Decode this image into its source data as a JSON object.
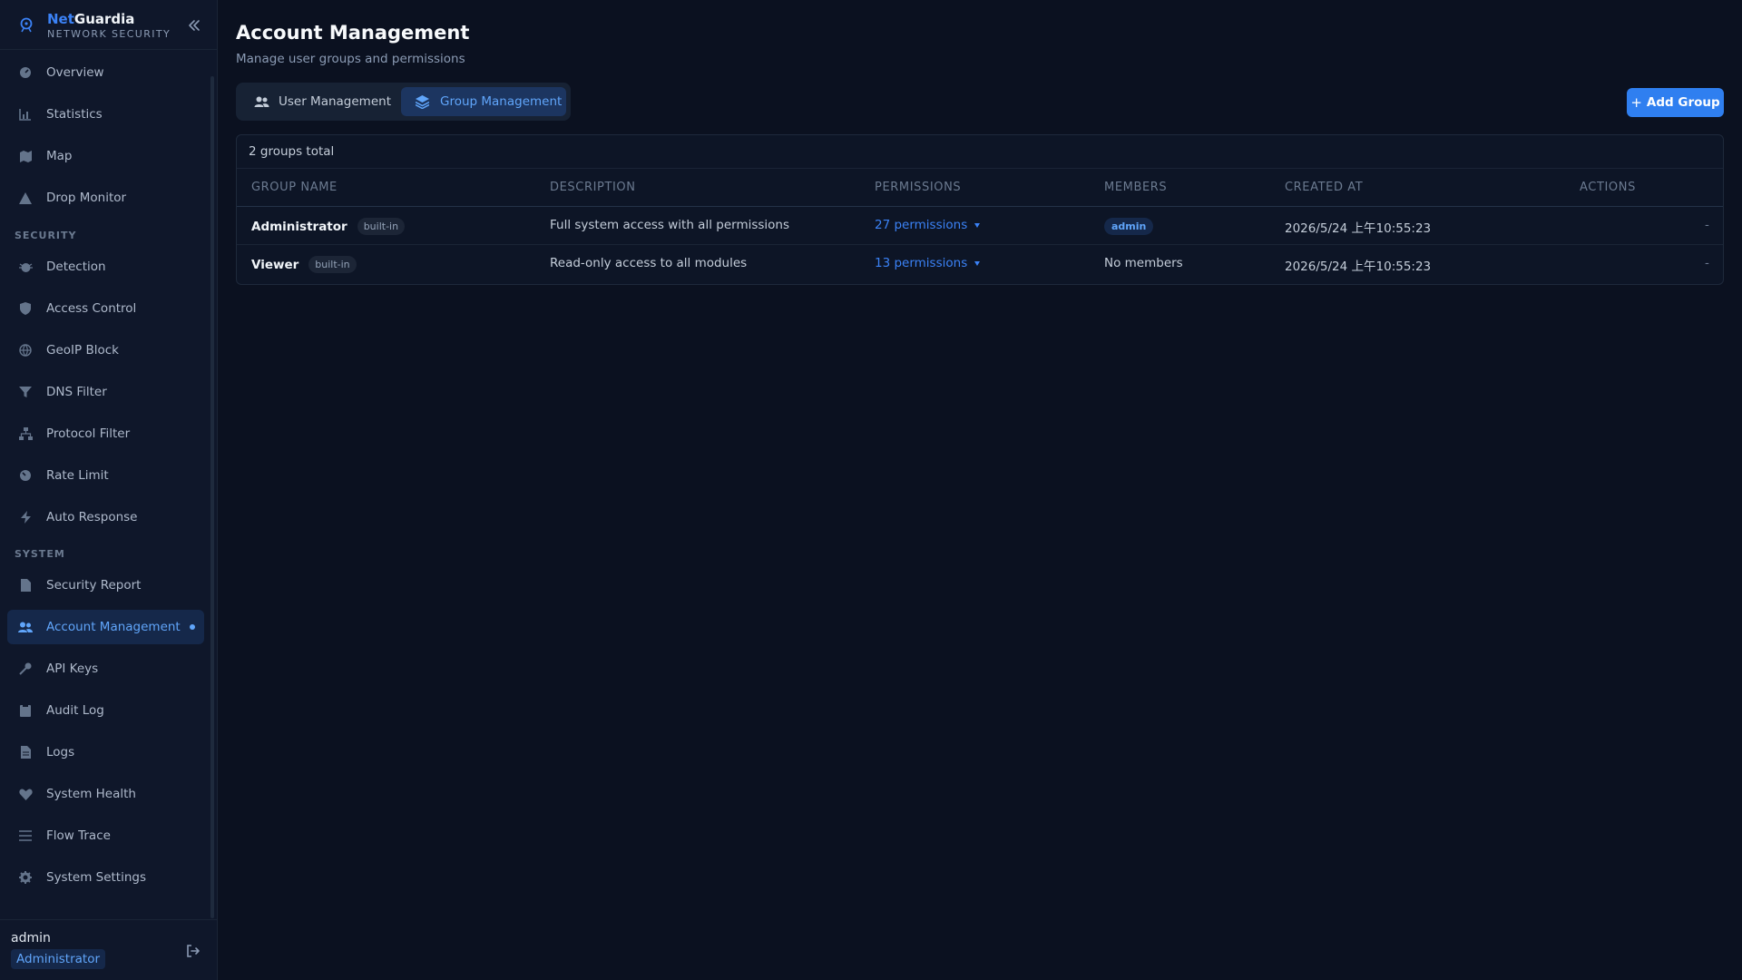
{
  "brand": {
    "name_accent": "Net",
    "name_rest": "Guardia",
    "tagline": "NETWORK SECURITY"
  },
  "sidebar": {
    "items_top": [
      {
        "label": "Overview",
        "icon": "gauge-icon"
      },
      {
        "label": "Statistics",
        "icon": "bar-chart-icon"
      },
      {
        "label": "Map",
        "icon": "map-icon"
      },
      {
        "label": "Drop Monitor",
        "icon": "warning-icon"
      }
    ],
    "section_security": "SECURITY",
    "items_security": [
      {
        "label": "Detection",
        "icon": "bug-icon"
      },
      {
        "label": "Access Control",
        "icon": "shield-icon"
      },
      {
        "label": "GeoIP Block",
        "icon": "globe-icon"
      },
      {
        "label": "DNS Filter",
        "icon": "filter-icon"
      },
      {
        "label": "Protocol Filter",
        "icon": "network-icon"
      },
      {
        "label": "Rate Limit",
        "icon": "speedometer-icon"
      },
      {
        "label": "Auto Response",
        "icon": "bolt-icon"
      }
    ],
    "section_system": "SYSTEM",
    "items_system": [
      {
        "label": "Security Report",
        "icon": "file-icon"
      },
      {
        "label": "Account Management",
        "icon": "users-icon",
        "active": true
      },
      {
        "label": "API Keys",
        "icon": "key-icon"
      },
      {
        "label": "Audit Log",
        "icon": "clipboard-icon"
      },
      {
        "label": "Logs",
        "icon": "document-icon"
      },
      {
        "label": "System Health",
        "icon": "heartbeat-icon"
      },
      {
        "label": "Flow Trace",
        "icon": "list-icon"
      },
      {
        "label": "System Settings",
        "icon": "gear-icon"
      }
    ]
  },
  "user": {
    "name": "admin",
    "role": "Administrator"
  },
  "header": {
    "title": "Account Management",
    "subtitle": "Manage user groups and permissions"
  },
  "tabs": [
    {
      "label": "User Management",
      "active": false
    },
    {
      "label": "Group Management",
      "active": true
    }
  ],
  "add_button": "Add Group",
  "table": {
    "total": "2 groups total",
    "columns": [
      "GROUP NAME",
      "DESCRIPTION",
      "PERMISSIONS",
      "MEMBERS",
      "CREATED AT",
      "ACTIONS"
    ],
    "rows": [
      {
        "name": "Administrator",
        "tag": "built-in",
        "description": "Full system access with all permissions",
        "permissions": "27 permissions",
        "members": "admin",
        "members_is_tag": true,
        "created_at": "2026/5/24 上午10:55:23",
        "actions": "-"
      },
      {
        "name": "Viewer",
        "tag": "built-in",
        "description": "Read-only access to all modules",
        "permissions": "13 permissions",
        "members": "No members",
        "members_is_tag": false,
        "created_at": "2026/5/24 上午10:55:23",
        "actions": "-"
      }
    ]
  },
  "colors": {
    "accent": "#3b82f6",
    "background": "#0b1120",
    "sidebar": "#0f172a",
    "primary_button": "#2f7ff0"
  }
}
